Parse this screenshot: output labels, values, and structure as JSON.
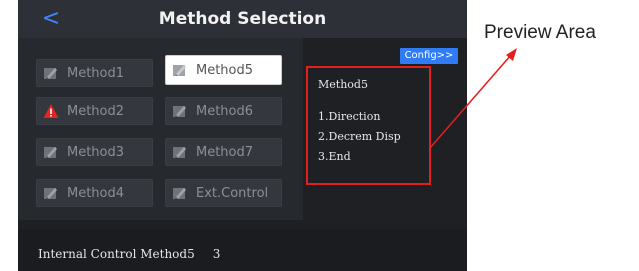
{
  "header": {
    "title": "Method Selection",
    "back_icon": "chevron-left-icon",
    "back_glyph": "<"
  },
  "methods": [
    {
      "label": "Method1",
      "icon": "edit-icon",
      "selected": false
    },
    {
      "label": "Method5",
      "icon": "edit-icon",
      "selected": true
    },
    {
      "label": "Method2",
      "icon": "warning-icon",
      "selected": false
    },
    {
      "label": "Method6",
      "icon": "edit-icon",
      "selected": false
    },
    {
      "label": "Method3",
      "icon": "edit-icon",
      "selected": false
    },
    {
      "label": "Method7",
      "icon": "edit-icon",
      "selected": false
    },
    {
      "label": "Method4",
      "icon": "edit-icon",
      "selected": false
    },
    {
      "label": "Ext.Control",
      "icon": "edit-icon",
      "selected": false
    }
  ],
  "config_button": {
    "label": "Config>>"
  },
  "preview": {
    "title": "Method5",
    "steps": [
      "1.Direction",
      "2.Decrem Disp",
      "3.End"
    ]
  },
  "status_bar": {
    "text": "Internal Control Method5",
    "value": "3"
  },
  "annotation": {
    "label": "Preview Area"
  },
  "colors": {
    "accent_blue": "#2f7cf6",
    "highlight_red": "#e32020",
    "panel_dark": "#1e2024",
    "warning_red": "#e02525"
  }
}
